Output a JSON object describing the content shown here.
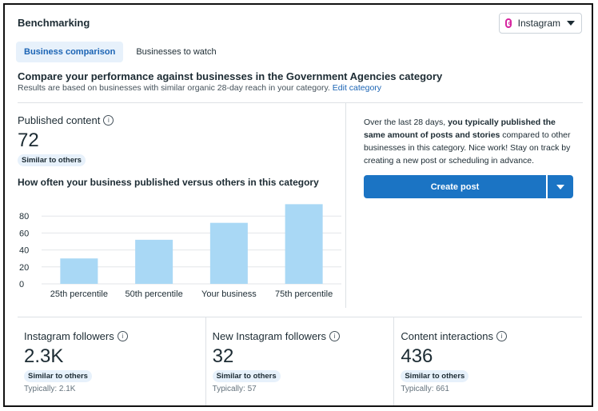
{
  "header": {
    "title": "Benchmarking",
    "platform": "Instagram"
  },
  "tabs": [
    "Business comparison",
    "Businesses to watch"
  ],
  "intro": {
    "headline": "Compare your performance against businesses in the Government Agencies category",
    "subtext": "Results are based on businesses with similar organic 28-day reach in your category.",
    "link": "Edit category"
  },
  "published": {
    "label": "Published content",
    "value": "72",
    "badge": "Similar to others",
    "chart_title": "How often your business published versus others in this category"
  },
  "insight": {
    "text_before": "Over the last 28 days,",
    "text_bold": "you typically published the same amount of posts and stories",
    "text_after": "compared to other businesses in this category. Nice work! Stay on track by creating a new post or scheduling in advance.",
    "button": "Create post"
  },
  "stats": [
    {
      "label": "Instagram followers",
      "value": "2.3K",
      "badge": "Similar to others",
      "typical": "Typically: 2.1K"
    },
    {
      "label": "New Instagram followers",
      "value": "32",
      "badge": "Similar to others",
      "typical": "Typically: 57"
    },
    {
      "label": "Content interactions",
      "value": "436",
      "badge": "Similar to others",
      "typical": "Typically: 661"
    }
  ],
  "colors": {
    "bar": "#a9d8f5",
    "accent": "#1b74c4"
  },
  "chart_data": {
    "type": "bar",
    "categories": [
      "25th percentile",
      "50th percentile",
      "Your business",
      "75th percentile"
    ],
    "values": [
      30,
      52,
      72,
      94
    ],
    "ylim": [
      0,
      100
    ],
    "yticks": [
      0,
      20,
      40,
      60,
      80
    ],
    "xlabel": "",
    "ylabel": ""
  }
}
